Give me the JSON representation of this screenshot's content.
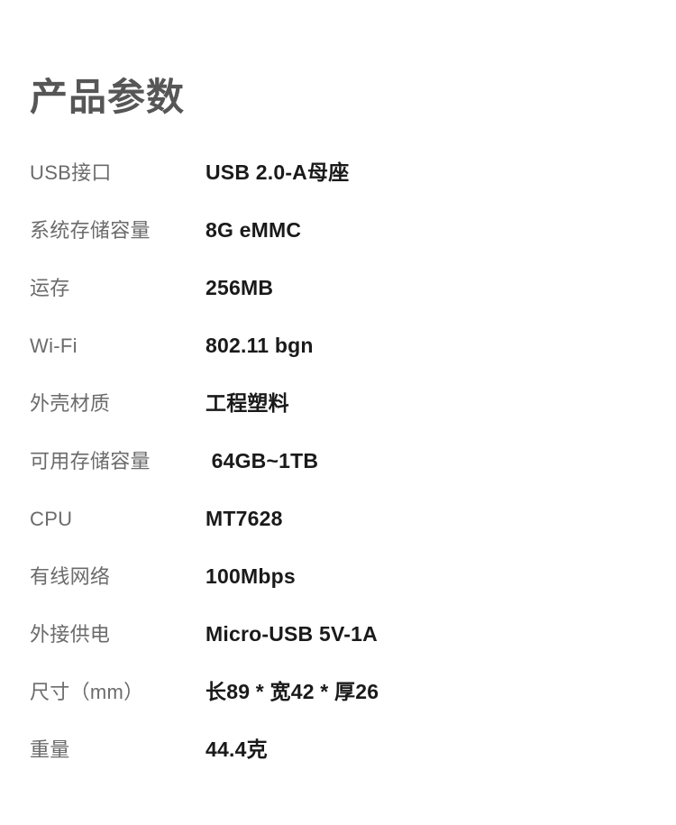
{
  "page": {
    "title": "产品参数",
    "background_color": "#ffffff",
    "title_color": "#565656",
    "label_color": "#6b6b6b",
    "value_color": "#1a1a1a"
  },
  "specs": [
    {
      "label": "USB接口",
      "value": "USB 2.0-A母座"
    },
    {
      "label": "系统存储容量",
      "value": "8G eMMC"
    },
    {
      "label": "运存",
      "value": "256MB"
    },
    {
      "label": "Wi-Fi",
      "value": "802.11 bgn"
    },
    {
      "label": "外壳材质",
      "value": "工程塑料"
    },
    {
      "label": "可用存储容量",
      "value": " 64GB~1TB"
    },
    {
      "label": "CPU",
      "value": "MT7628"
    },
    {
      "label": "有线网络",
      "value": "100Mbps"
    },
    {
      "label": "外接供电",
      "value": "Micro-USB 5V-1A"
    },
    {
      "label": "尺寸（mm）",
      "value": "长89 * 宽42 * 厚26"
    },
    {
      "label": "重量",
      "value": "44.4克"
    }
  ]
}
